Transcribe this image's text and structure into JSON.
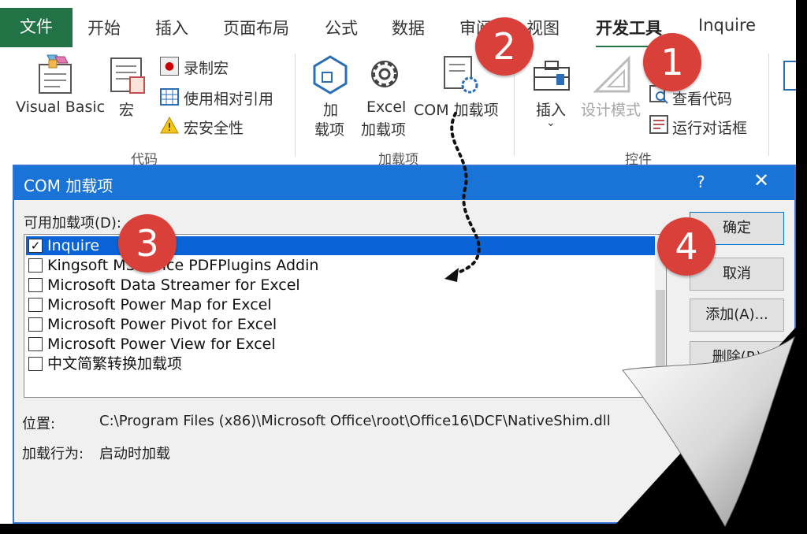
{
  "tabs": {
    "file": "文件",
    "home": "开始",
    "insert": "插入",
    "page_layout": "页面布局",
    "formulas": "公式",
    "data": "数据",
    "review": "审阅",
    "view": "视图",
    "developer": "开发工具",
    "inquire": "Inquire"
  },
  "ribbon": {
    "code": {
      "visual_basic": "Visual Basic",
      "macros": "宏",
      "record_macro": "录制宏",
      "relative_refs": "使用相对引用",
      "macro_security": "宏安全性",
      "group_label": "代码"
    },
    "addins": {
      "addins_line1": "加",
      "addins_line2": "载项",
      "excel_addins_line1": "Excel",
      "excel_addins_line2": "加载项",
      "com_addins": "COM 加载项",
      "group_label": "加载项"
    },
    "controls": {
      "insert": "插入",
      "design_mode": "设计模式",
      "view_code": "查看代码",
      "run_dialog": "运行对话框",
      "group_label": "控件"
    }
  },
  "dialog": {
    "title": "COM 加载项",
    "help": "?",
    "close": "✕",
    "available_label": "可用加载项(D):",
    "items": [
      {
        "label": "Inquire",
        "checked": true
      },
      {
        "label": "Kingsoft MS Office PDFPlugins Addin",
        "checked": false
      },
      {
        "label": "Microsoft Data Streamer for Excel",
        "checked": false
      },
      {
        "label": "Microsoft Power Map for Excel",
        "checked": false
      },
      {
        "label": "Microsoft Power Pivot for Excel",
        "checked": false
      },
      {
        "label": "Microsoft Power View for Excel",
        "checked": false
      },
      {
        "label": "中文简繁转换加载项",
        "checked": false
      }
    ],
    "buttons": {
      "ok": "确定",
      "cancel": "取消",
      "add": "添加(A)...",
      "remove": "删除(R)"
    },
    "location_label": "位置:",
    "location_value": "C:\\Program Files (x86)\\Microsoft Office\\root\\Office16\\DCF\\NativeShim.dll",
    "behavior_label": "加载行为:",
    "behavior_value": "启动时加载"
  },
  "markers": {
    "m1": "1",
    "m2": "2",
    "m3": "3",
    "m4": "4"
  },
  "colors": {
    "excel_green": "#217346",
    "dialog_title_blue": "#1a73d6",
    "selection_blue": "#0a64d8",
    "marker_red": "#d9403a"
  }
}
